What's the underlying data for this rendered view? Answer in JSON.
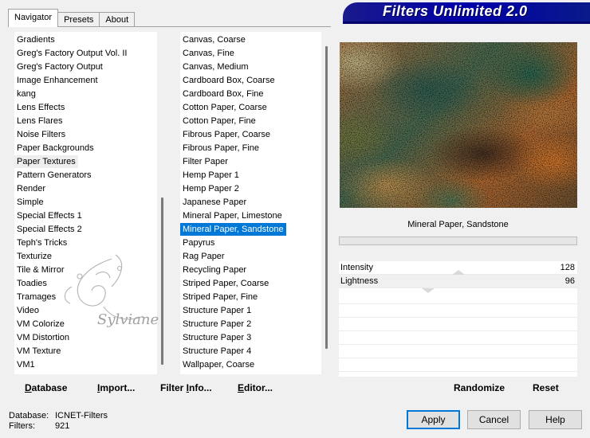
{
  "tabs": [
    "Navigator",
    "Presets",
    "About"
  ],
  "banner_title": "Filters Unlimited 2.0",
  "categories": {
    "items": [
      "Gradients",
      "Greg's Factory Output Vol. II",
      "Greg's Factory Output",
      "Image Enhancement",
      "kang",
      "Lens Effects",
      "Lens Flares",
      "Noise Filters",
      "Paper Backgrounds",
      "Paper Textures",
      "Pattern Generators",
      "Render",
      "Simple",
      "Special Effects 1",
      "Special Effects 2",
      "Teph's Tricks",
      "Texturize",
      "Tile & Mirror",
      "Toadies",
      "Tramages",
      "Video",
      "VM Colorize",
      "VM Distortion",
      "VM Texture",
      "VM1"
    ],
    "focused_index": 9
  },
  "filters": {
    "items": [
      "Canvas, Coarse",
      "Canvas, Fine",
      "Canvas, Medium",
      "Cardboard Box, Coarse",
      "Cardboard Box, Fine",
      "Cotton Paper, Coarse",
      "Cotton Paper, Fine",
      "Fibrous Paper, Coarse",
      "Fibrous Paper, Fine",
      "Filter Paper",
      "Hemp Paper 1",
      "Hemp Paper 2",
      "Japanese Paper",
      "Mineral Paper, Limestone",
      "Mineral Paper, Sandstone",
      "Papyrus",
      "Rag Paper",
      "Recycling Paper",
      "Striped Paper, Coarse",
      "Striped Paper, Fine",
      "Structure Paper 1",
      "Structure Paper 2",
      "Structure Paper 3",
      "Structure Paper 4",
      "Wallpaper, Coarse"
    ],
    "selected_index": 14
  },
  "selected_filter_name": "Mineral Paper, Sandstone",
  "progress_fraction": 0,
  "params": [
    {
      "label": "Intensity",
      "value": "128",
      "level": 0.5
    },
    {
      "label": "Lightness",
      "value": "96",
      "level": 0.376
    }
  ],
  "toolbar": {
    "database": {
      "ul": "D",
      "rest": "atabase"
    },
    "import": {
      "ul": "I",
      "rest": "mport..."
    },
    "filter_info": {
      "pre": "Filter ",
      "ul": "I",
      "rest": "nfo..."
    },
    "editor": {
      "ul": "E",
      "rest": "ditor..."
    }
  },
  "randomize_label": "Randomize",
  "reset_label": "Reset",
  "status": {
    "database_label": "Database:",
    "database_value": "ICNET-Filters",
    "filters_label": "Filters:",
    "filters_value": "921"
  },
  "buttons": {
    "apply": "Apply",
    "cancel": "Cancel",
    "help": "Help"
  },
  "watermark_text": "Sylviane",
  "colors": {
    "banner": "#0000aa",
    "selection": "#0078d7",
    "progress": "#06b025"
  }
}
